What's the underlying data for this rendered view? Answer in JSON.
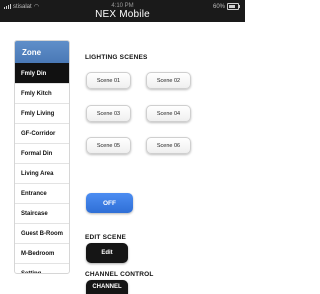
{
  "status_bar": {
    "carrier": "stisalat",
    "time": "4:10 PM",
    "battery": "60%"
  },
  "app": {
    "title": "NEX Mobile"
  },
  "sidebar": {
    "header": "Zone",
    "items": [
      {
        "label": "Fmly Din"
      },
      {
        "label": "Fmly Kitch"
      },
      {
        "label": "Fmly Living"
      },
      {
        "label": "GF-Corridor"
      },
      {
        "label": "Formal Din"
      },
      {
        "label": "Living Area"
      },
      {
        "label": "Entrance"
      },
      {
        "label": "Staircase"
      },
      {
        "label": "Guest B-Room"
      },
      {
        "label": "M-Bedroom"
      },
      {
        "label": "Setting"
      }
    ],
    "active_index": 0
  },
  "lighting": {
    "title": "LIGHTING SCENES",
    "scenes": [
      "Scene 01",
      "Scene 02",
      "Scene 03",
      "Scene 04",
      "Scene 05",
      "Scene 06"
    ],
    "off_label": "OFF"
  },
  "edit_scene": {
    "title": "EDIT SCENE",
    "button_label": "Edit"
  },
  "channel_control": {
    "title": "CHANNEL CONTROL",
    "button_label": "CHANNEL"
  },
  "colors": {
    "accent_blue": "#3a7de6",
    "zone_header": "#5585c2",
    "dark_button": "#151515"
  }
}
